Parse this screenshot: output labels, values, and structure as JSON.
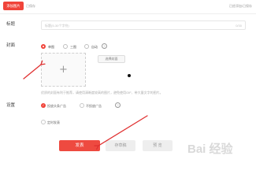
{
  "toolbar": {
    "insert_image_label": "添加图片",
    "saved_status": "已保存",
    "autosave_text": "已经添加/已保存"
  },
  "title": {
    "label": "标题",
    "placeholder": "标题(5-30个字符)",
    "count": "0/30"
  },
  "cover": {
    "label": "封面",
    "options": [
      "单图",
      "三图",
      "自动"
    ],
    "selected_option": "单图",
    "select_image_button": "选择封面",
    "tip": "优质的封面有利于推荐，请使用清晰度较高的图片，避免使用GIF、带大量文字的图片。"
  },
  "settings": {
    "label": "设置",
    "ads_on": "投放头条广告",
    "ads_off": "不投放广告",
    "schedule": "定时发表",
    "ads_on_checked": true
  },
  "actions": {
    "publish_label": "发表",
    "preview_label": "存草稿",
    "save_label": "预 览"
  },
  "watermark": {
    "text": "Bai 经验"
  },
  "colors": {
    "accent": "#f0443a",
    "annotation_arrow": "#e03030"
  },
  "icons": {
    "add_cover": "plus-icon",
    "help": "question-icon"
  }
}
